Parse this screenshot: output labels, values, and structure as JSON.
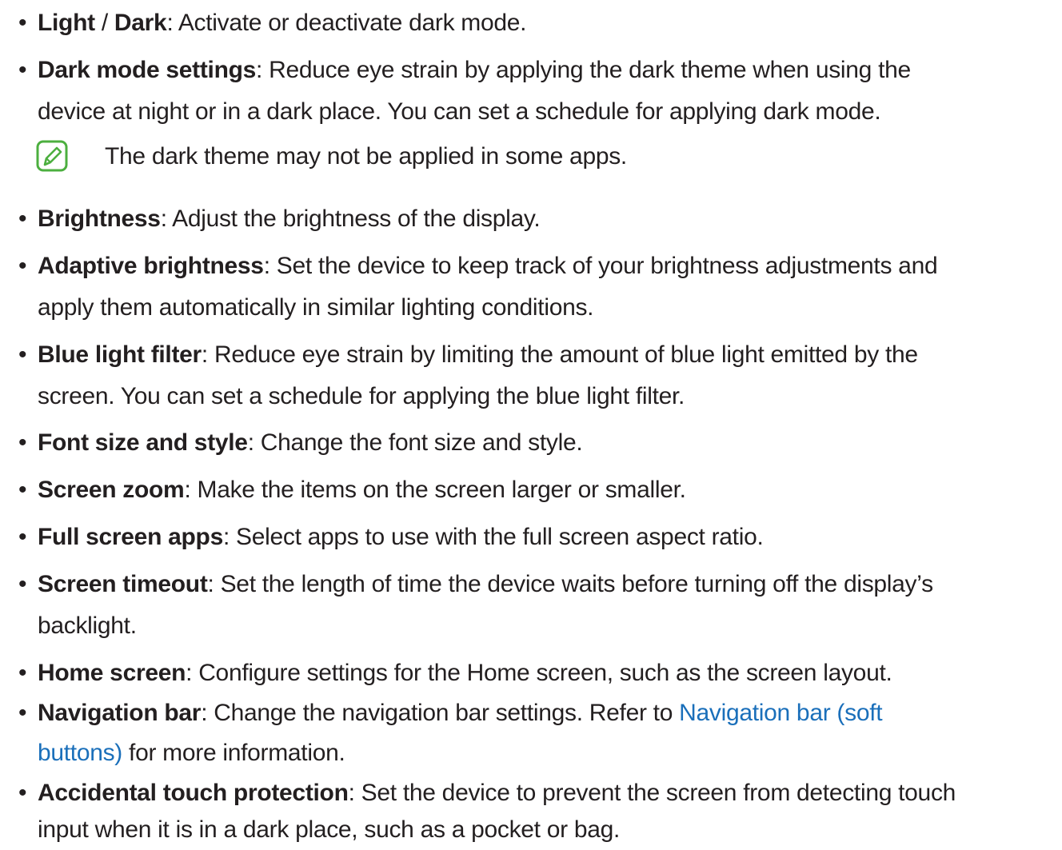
{
  "items": [
    {
      "term_a": "Light",
      "separator": " / ",
      "term_b": "Dark",
      "desc": ": Activate or deactivate dark mode."
    },
    {
      "term": "Dark mode settings",
      "desc_line1": ": Reduce eye strain by applying the dark theme when using the",
      "desc_line2": "device at night or in a dark place. You can set a schedule for applying dark mode."
    },
    {
      "term": "Brightness",
      "desc": ": Adjust the brightness of the display."
    },
    {
      "term": "Adaptive brightness",
      "desc_line1": ": Set the device to keep track of your brightness adjustments and",
      "desc_line2": "apply them automatically in similar lighting conditions."
    },
    {
      "term": "Blue light filter",
      "desc_line1": ": Reduce eye strain by limiting the amount of blue light emitted by the",
      "desc_line2": "screen. You can set a schedule for applying the blue light filter."
    },
    {
      "term": "Font size and style",
      "desc": ": Change the font size and style."
    },
    {
      "term": "Screen zoom",
      "desc": ": Make the items on the screen larger or smaller."
    },
    {
      "term": "Full screen apps",
      "desc": ": Select apps to use with the full screen aspect ratio."
    },
    {
      "term": "Screen timeout",
      "desc_line1": ": Set the length of time the device waits before turning off the display’s",
      "desc_line2": "backlight."
    },
    {
      "term": "Home screen",
      "desc": ": Configure settings for the Home screen, such as the screen layout."
    },
    {
      "term": "Navigation bar",
      "desc_line1_a": ": Change the navigation bar settings. Refer to ",
      "link_line1": "Navigation bar (soft",
      "link_line2": "buttons)",
      "desc_line2_b": " for more information."
    },
    {
      "term": "Accidental touch protection",
      "desc_line1": ": Set the device to prevent the screen from detecting touch",
      "desc_line2": "input when it is in a dark place, such as a pocket or bag."
    }
  ],
  "note": {
    "icon": "note-pencil-icon",
    "text": "The dark theme may not be applied in some apps."
  },
  "bullet_char": "•",
  "colors": {
    "text": "#231f20",
    "link": "#1a6fba",
    "note_icon": "#4caf3f"
  }
}
